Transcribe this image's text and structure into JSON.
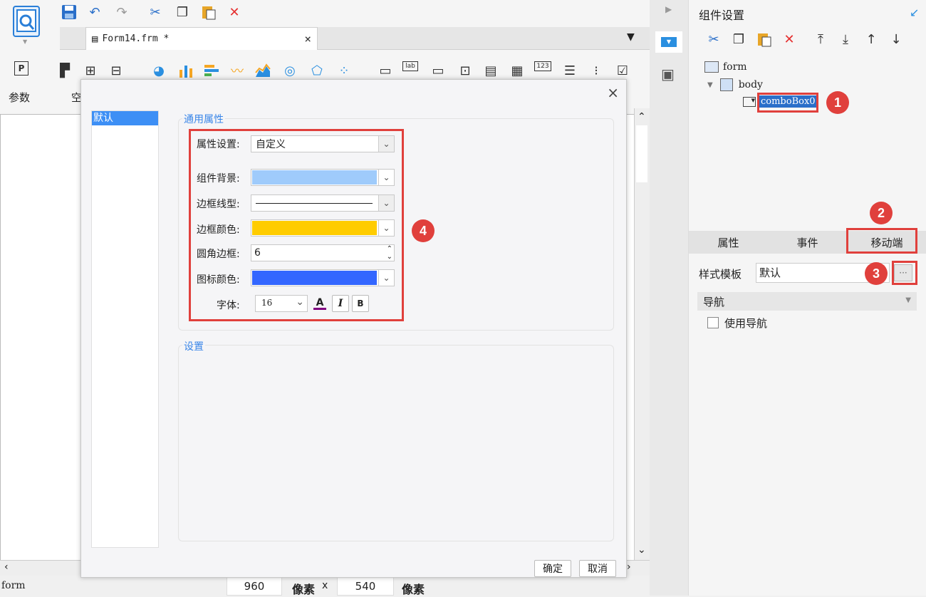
{
  "toolbar": {
    "params_label": "参数",
    "partial_label": "空"
  },
  "file_tab": {
    "name": "Form14.frm *",
    "close": "×"
  },
  "status": {
    "left_text": "form",
    "width": "960",
    "height": "540",
    "unit1": "像素",
    "unit2": "像素",
    "times": "x"
  },
  "dialog": {
    "close": "×",
    "list_items": [
      "默认"
    ],
    "section_general": "通用属性",
    "section_settings": "设置",
    "props": {
      "attr_setting_label": "属性设置:",
      "attr_setting_value": "自定义",
      "bg_label": "组件背景:",
      "bg_color": "#9fcbfb",
      "border_style_label": "边框线型:",
      "border_color_label": "边框颜色:",
      "border_color": "#ffcc00",
      "radius_label": "圆角边框:",
      "radius_value": "6",
      "icon_color_label": "图标颜色:",
      "icon_color": "#3366ff",
      "font_label": "字体:",
      "font_size": "16",
      "font_color_btn": "A",
      "italic_btn": "I",
      "bold_btn": "B"
    },
    "ok": "确定",
    "cancel": "取消"
  },
  "right_panel": {
    "title": "组件设置",
    "tree": {
      "form": "form",
      "body": "body",
      "combo": "comboBox0"
    },
    "tabs": [
      "属性",
      "事件",
      "移动端"
    ],
    "style_template_label": "样式模板",
    "style_template_value": "默认",
    "more_btn": "···",
    "nav_section": "导航",
    "use_nav_label": "使用导航"
  },
  "badges": [
    "1",
    "2",
    "3",
    "4"
  ],
  "accent_color": "#e0403c"
}
